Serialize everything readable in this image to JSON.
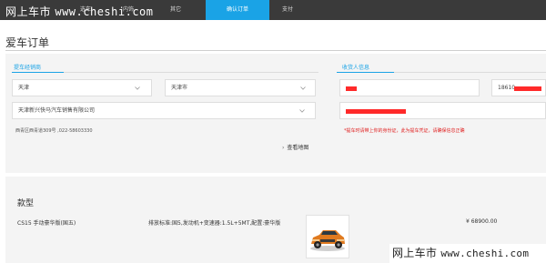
{
  "watermark": {
    "top_name": "网上车市",
    "top_url": "www.cheshi.com",
    "bottom_name": "网上车市",
    "bottom_url": "www.cheshi.com"
  },
  "nav": {
    "tabs": [
      {
        "label": "选车"
      },
      {
        "label": "内饰"
      },
      {
        "label": "其它"
      },
      {
        "label": "确认订单",
        "active": true
      },
      {
        "label": "支付"
      }
    ]
  },
  "page": {
    "title": "爱车订单"
  },
  "dealer": {
    "section_title": "提车经销商",
    "province": "天津",
    "city": "天津市",
    "dealer_name": "天津新兴快马汽车销售有限公司",
    "address": "西青区西青道309号 ,022-58603330",
    "map_link": "查看地图"
  },
  "receiver": {
    "section_title": "收货人信息",
    "phone_prefix": "18610",
    "id_note": "*提车时请带上你的身份证，此为提车凭证，请确保信息正确"
  },
  "product": {
    "section_title": "款型",
    "name": "CS15 手动豪华版(国五)",
    "spec": "排放标准:国5,发动机+变速器:1.5L+5MT,配置:豪华版",
    "price": "¥ 68900.00"
  },
  "colors": {
    "accent": "#1aa3e6",
    "nav_bg": "#3a3a3a",
    "redaction": "#ff2a2a"
  }
}
